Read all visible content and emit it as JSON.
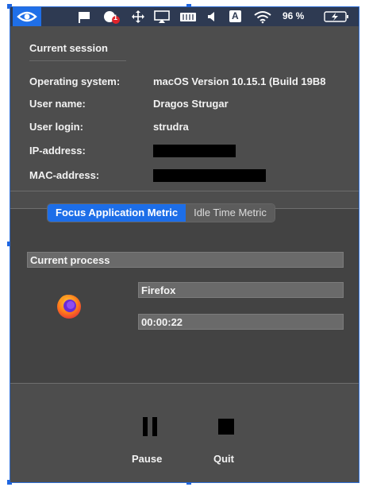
{
  "menubar": {
    "input_badge": "A",
    "notification_count": "1",
    "battery_percent": "96 %"
  },
  "session": {
    "title": "Current session",
    "rows": [
      {
        "label": "Operating system:",
        "value": "macOS Version 10.15.1 (Build 19B8"
      },
      {
        "label": "User name:",
        "value": "Dragos Strugar"
      },
      {
        "label": "User login:",
        "value": "strudra"
      },
      {
        "label": "IP-address:",
        "value": ""
      },
      {
        "label": "MAC-address:",
        "value": ""
      }
    ]
  },
  "tabs": [
    {
      "label": "Focus Application Metric",
      "active": true
    },
    {
      "label": "Idle Time Metric",
      "active": false
    }
  ],
  "current_process": {
    "header": "Current process",
    "app_name": "Firefox",
    "elapsed": "00:00:22",
    "icon": "firefox-icon"
  },
  "controls": {
    "pause_label": "Pause",
    "quit_label": "Quit"
  },
  "colors": {
    "accent": "#1d6ee8",
    "panel": "#4d4d4d",
    "menubar": "#2e3a52"
  }
}
